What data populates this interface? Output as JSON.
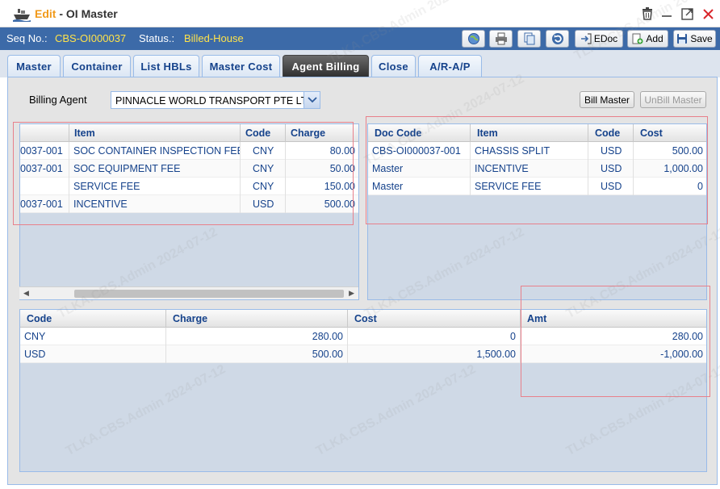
{
  "window": {
    "mode_label": "Edit",
    "separator": " - ",
    "title": "OI Master",
    "icons": [
      "ship-icon",
      "trash-icon",
      "minimize-icon",
      "maximize-icon",
      "close-icon"
    ]
  },
  "seqbar": {
    "seq_label": "Seq No.:",
    "seq_value": "CBS-OI000037",
    "status_label": "Status.:",
    "status_value": "Billed-House"
  },
  "toolbar": {
    "edoc_label": "EDoc",
    "add_label": "Add",
    "save_label": "Save"
  },
  "tabs": [
    {
      "label": "Master"
    },
    {
      "label": "Container"
    },
    {
      "label": "List HBLs"
    },
    {
      "label": "Master Cost"
    },
    {
      "label": "Agent Billing"
    },
    {
      "label": "Close"
    },
    {
      "label": "A/R-A/P"
    }
  ],
  "billing": {
    "agent_label": "Billing Agent",
    "agent_value": "PINNACLE WORLD TRANSPORT PTE LTD",
    "bill_master_label": "Bill Master",
    "unbill_master_label": "UnBill Master"
  },
  "charge_grid": {
    "headers": [
      "",
      "Item",
      "Code",
      "Charge"
    ],
    "rows": [
      [
        "0037-001",
        "SOC CONTAINER INSPECTION FEE",
        "CNY",
        "80.00"
      ],
      [
        "0037-001",
        "SOC EQUIPMENT FEE",
        "CNY",
        "50.00"
      ],
      [
        "",
        "SERVICE FEE",
        "CNY",
        "150.00"
      ],
      [
        "0037-001",
        "INCENTIVE",
        "USD",
        "500.00"
      ]
    ]
  },
  "cost_grid": {
    "headers": [
      "Doc Code",
      "Item",
      "Code",
      "Cost"
    ],
    "rows": [
      [
        "CBS-OI000037-001",
        "CHASSIS SPLIT",
        "USD",
        "500.00"
      ],
      [
        "Master",
        "INCENTIVE",
        "USD",
        "1,000.00"
      ],
      [
        "Master",
        "SERVICE FEE",
        "USD",
        "0"
      ]
    ]
  },
  "summary_grid": {
    "headers": [
      "Code",
      "Charge",
      "Cost",
      "Amt"
    ],
    "rows": [
      [
        "CNY",
        "280.00",
        "0",
        "280.00"
      ],
      [
        "USD",
        "500.00",
        "1,500.00",
        "-1,000.00"
      ]
    ]
  },
  "watermark": "TLKA.CBS.Admin 2024-07-12"
}
